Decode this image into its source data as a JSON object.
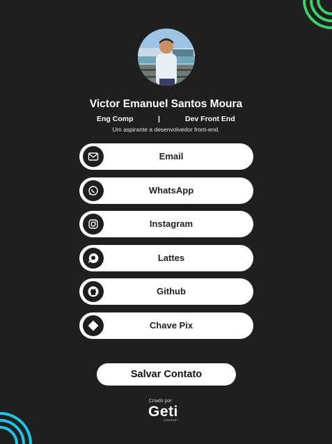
{
  "profile": {
    "name": "Victor Emanuel Santos Moura",
    "role_left": "Eng Comp",
    "role_separator": "|",
    "role_right": "Dev Front End",
    "tagline": "Um aspirante a desenvolvedor front-end."
  },
  "links": [
    {
      "label": "Email",
      "icon": "envelope-icon"
    },
    {
      "label": "WhatsApp",
      "icon": "whatsapp-icon"
    },
    {
      "label": "Instagram",
      "icon": "instagram-icon"
    },
    {
      "label": "Lattes",
      "icon": "lattes-icon"
    },
    {
      "label": "Github",
      "icon": "github-icon"
    },
    {
      "label": "Chave Pix",
      "icon": "pix-icon"
    }
  ],
  "save_contact": "Salvar Contato",
  "footer": {
    "credit": "Criado por",
    "logo_main": "Geti",
    "logo_sub": "COMPANY"
  },
  "colors": {
    "background": "#1f1f1f",
    "card": "#ffffff",
    "accent_green": "#3ecf6a",
    "accent_cyan": "#22c3e6",
    "logo_accent": "#f08a1c"
  }
}
